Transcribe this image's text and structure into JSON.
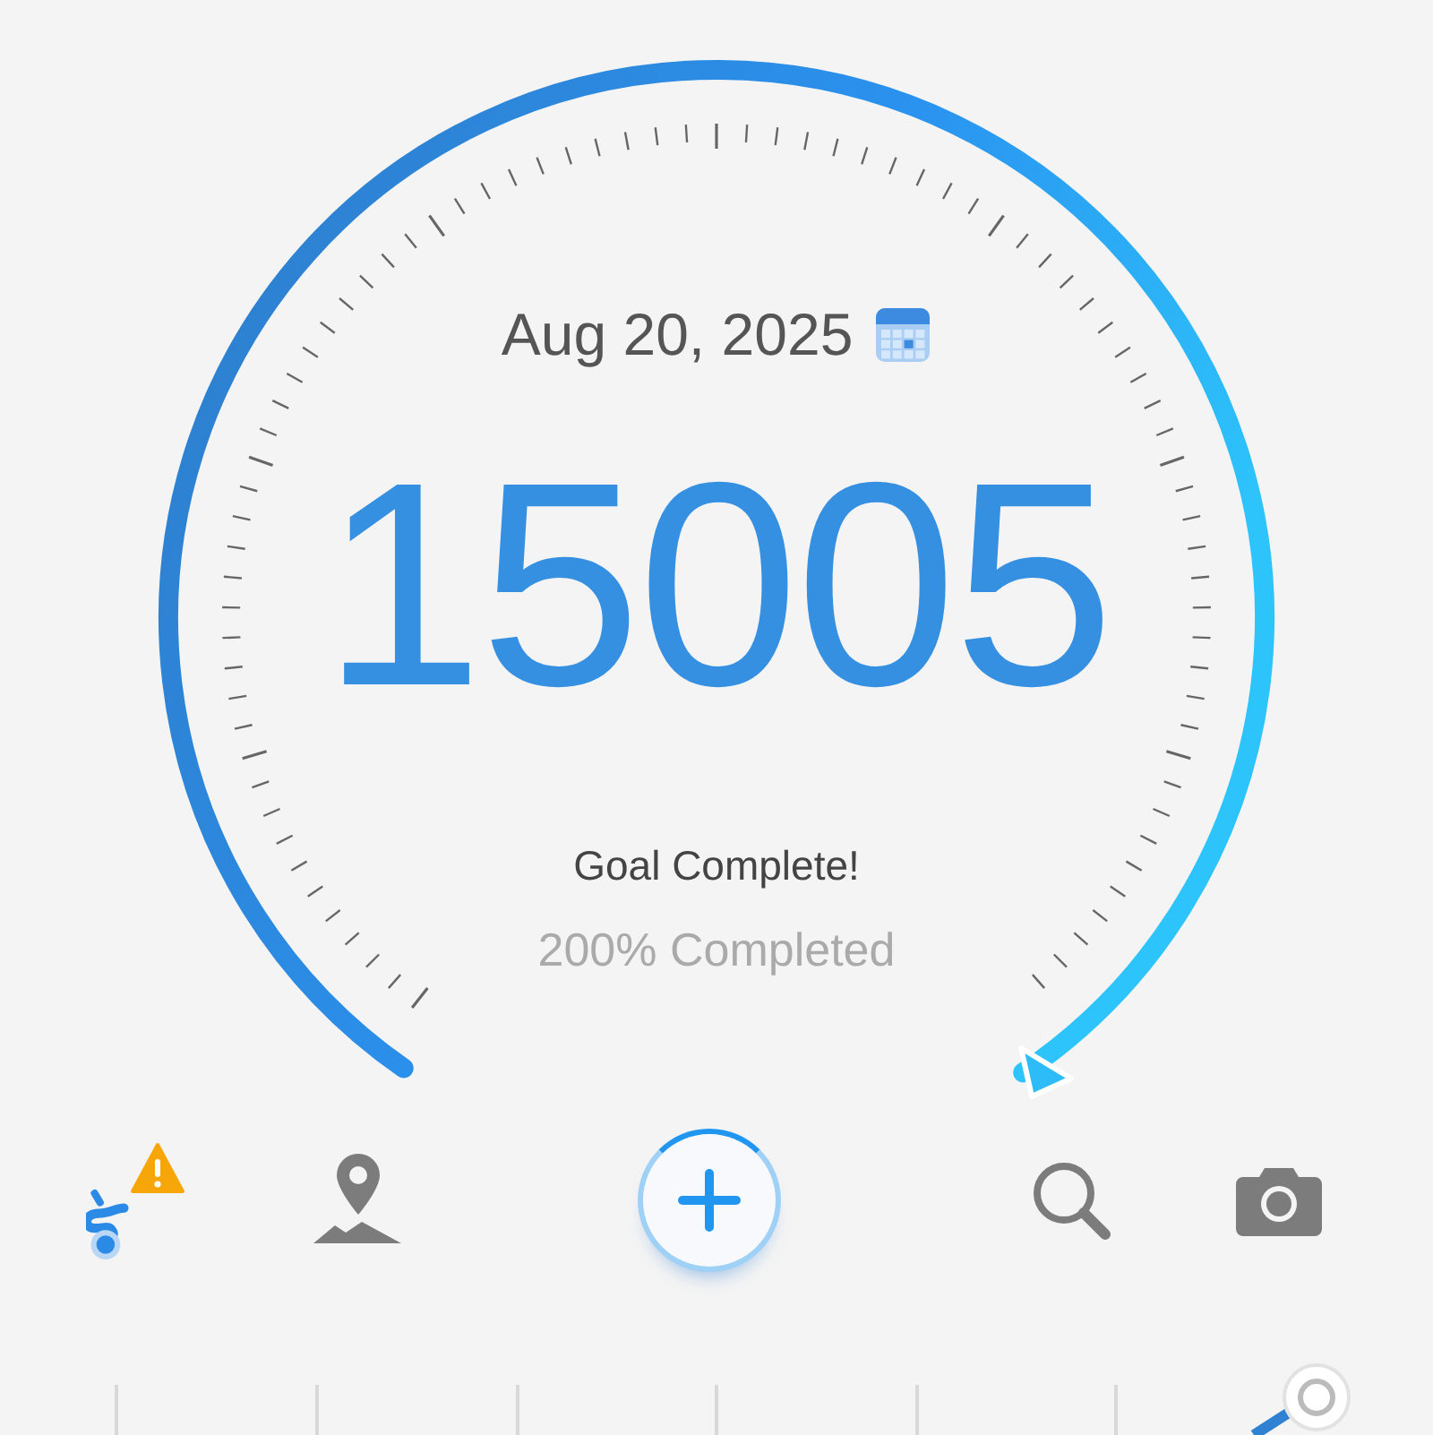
{
  "date": "Aug 20, 2025",
  "steps": "15005",
  "goal_message": "Goal Complete!",
  "progress_text": "200% Completed",
  "toolbar": [
    {
      "kind": "route",
      "warning": true
    },
    {
      "kind": "map"
    },
    {
      "kind": "add"
    },
    {
      "kind": "search"
    },
    {
      "kind": "camera"
    }
  ]
}
